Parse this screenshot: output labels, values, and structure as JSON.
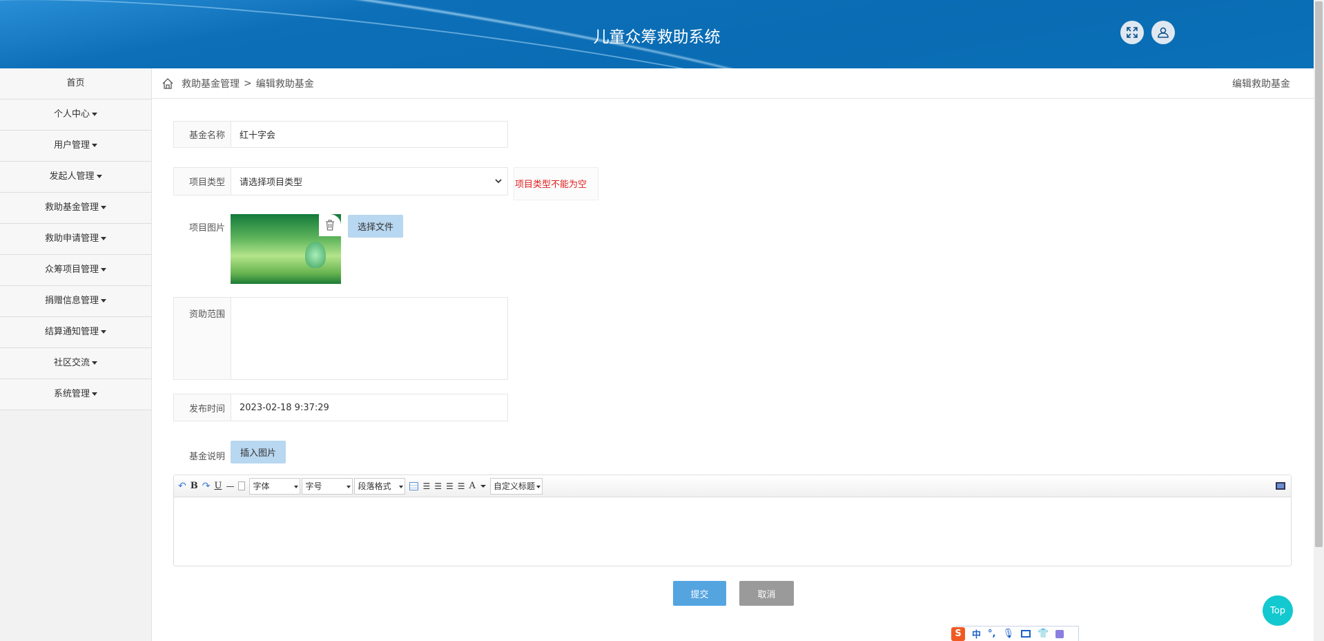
{
  "header": {
    "title": "儿童众筹救助系统"
  },
  "sidebar": {
    "items": [
      {
        "label": "首页",
        "dropdown": false
      },
      {
        "label": "个人中心",
        "dropdown": true
      },
      {
        "label": "用户管理",
        "dropdown": true
      },
      {
        "label": "发起人管理",
        "dropdown": true
      },
      {
        "label": "救助基金管理",
        "dropdown": true
      },
      {
        "label": "救助申请管理",
        "dropdown": true
      },
      {
        "label": "众筹项目管理",
        "dropdown": true
      },
      {
        "label": "捐赠信息管理",
        "dropdown": true
      },
      {
        "label": "结算通知管理",
        "dropdown": true
      },
      {
        "label": "社区交流",
        "dropdown": true
      },
      {
        "label": "系统管理",
        "dropdown": true
      }
    ]
  },
  "breadcrumb": {
    "parent": "救助基金管理",
    "sep": ">",
    "current": "编辑救助基金",
    "right": "编辑救助基金"
  },
  "form": {
    "name_label": "基金名称",
    "name_value": "红十字会",
    "type_label": "项目类型",
    "type_value": "请选择项目类型",
    "type_error": "项目类型不能为空",
    "image_label": "项目图片",
    "choose_file": "选择文件",
    "scope_label": "资助范围",
    "scope_value": "",
    "time_label": "发布时间",
    "time_value": "2023-02-18 9:37:29",
    "desc_label": "基金说明",
    "insert_image": "插入图片",
    "editor": {
      "bold": "B",
      "underline": "U",
      "hr": "—",
      "font": "字体",
      "size": "字号",
      "paragraph": "段落格式",
      "color": "A",
      "custom_title": "自定义标题"
    },
    "submit": "提交",
    "cancel": "取消"
  },
  "top_button": "Top",
  "ime": {
    "lang": "中",
    "punct": "°,"
  },
  "colors": {
    "primary_btn": "#54a4e0",
    "cancel_btn": "#9a9a9a",
    "light_btn": "#b8d7f0",
    "error": "#e02020",
    "top": "#13c9cf"
  }
}
